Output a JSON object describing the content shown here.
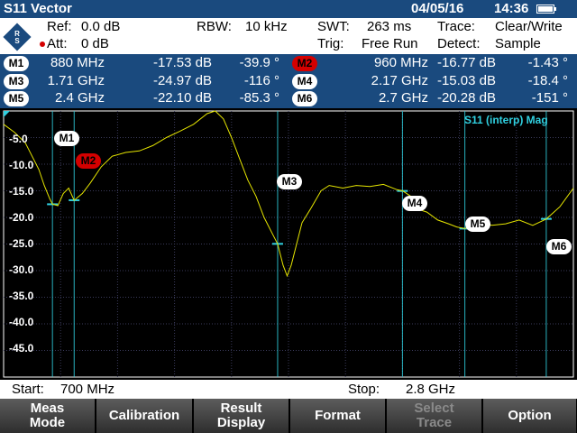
{
  "title_bar": {
    "title": "S11 Vector",
    "date": "04/05/16",
    "time": "14:36"
  },
  "settings": {
    "ref_label": "Ref:",
    "ref_value": "0.0 dB",
    "att_label": "Att:",
    "att_value": "0 dB",
    "rbw_label": "RBW:",
    "rbw_value": "10 kHz",
    "swt_label": "SWT:",
    "swt_value": "263 ms",
    "trig_label": "Trig:",
    "trig_value": "Free Run",
    "trace_label": "Trace:",
    "trace_value": "Clear/Write",
    "detect_label": "Detect:",
    "detect_value": "Sample"
  },
  "markers": [
    {
      "id": "M1",
      "freq": "880 MHz",
      "mag": "-17.53 dB",
      "phase": "-39.9 °",
      "active": false
    },
    {
      "id": "M2",
      "freq": "960 MHz",
      "mag": "-16.77 dB",
      "phase": "-1.43 °",
      "active": true
    },
    {
      "id": "M3",
      "freq": "1.71 GHz",
      "mag": "-24.97 dB",
      "phase": "-116 °",
      "active": false
    },
    {
      "id": "M4",
      "freq": "2.17 GHz",
      "mag": "-15.03 dB",
      "phase": "-18.4 °",
      "active": false
    },
    {
      "id": "M5",
      "freq": "2.4 GHz",
      "mag": "-22.10 dB",
      "phase": "-85.3 °",
      "active": false
    },
    {
      "id": "M6",
      "freq": "2.7 GHz",
      "mag": "-20.28 dB",
      "phase": "-151 °",
      "active": false
    }
  ],
  "plot": {
    "trace_label": "S11 (interp) Mag",
    "y_ticks": [
      "-5.0",
      "-10.0",
      "-15.0",
      "-20.0",
      "-25.0",
      "-30.0",
      "-35.0",
      "-40.0",
      "-45.0"
    ],
    "trace_color": "#e6e600",
    "marker_line_color": "#30d0e0"
  },
  "chart_data": {
    "type": "line",
    "title": "S11 (interp) Mag",
    "xlabel": "",
    "ylabel": "",
    "xlim": [
      700,
      2800
    ],
    "ylim": [
      -50,
      0
    ],
    "x_unit": "MHz",
    "y_unit": "dB",
    "grid": true,
    "series": [
      {
        "name": "S11 (interp) Mag",
        "x": [
          700,
          740,
          780,
          800,
          830,
          850,
          870,
          880,
          900,
          920,
          940,
          960,
          990,
          1020,
          1060,
          1100,
          1150,
          1200,
          1250,
          1300,
          1350,
          1400,
          1450,
          1480,
          1510,
          1540,
          1570,
          1600,
          1630,
          1660,
          1690,
          1710,
          1730,
          1745,
          1760,
          1780,
          1800,
          1830,
          1870,
          1900,
          1950,
          2000,
          2050,
          2100,
          2150,
          2170,
          2200,
          2230,
          2260,
          2300,
          2340,
          2370,
          2400,
          2450,
          2500,
          2550,
          2600,
          2650,
          2700,
          2750,
          2800
        ],
        "y": [
          -2.5,
          -4.0,
          -6.0,
          -8.0,
          -11.0,
          -14.0,
          -16.5,
          -17.5,
          -17.8,
          -15.5,
          -14.5,
          -16.8,
          -15.5,
          -13.5,
          -10.5,
          -8.5,
          -7.8,
          -7.5,
          -6.5,
          -5.0,
          -3.8,
          -2.5,
          -0.5,
          0.0,
          -1.5,
          -5.0,
          -9.0,
          -13.0,
          -16.0,
          -20.0,
          -23.0,
          -25.0,
          -29.0,
          -31.0,
          -29.0,
          -25.0,
          -21.0,
          -18.5,
          -15.0,
          -14.0,
          -14.5,
          -14.0,
          -14.2,
          -13.8,
          -14.8,
          -15.0,
          -16.0,
          -18.5,
          -19.0,
          -20.5,
          -21.2,
          -21.8,
          -22.1,
          -21.0,
          -21.5,
          -21.2,
          -20.5,
          -21.5,
          -20.3,
          -18.0,
          -14.5
        ]
      }
    ]
  },
  "start_stop": {
    "start_label": "Start:",
    "start_value": "700 MHz",
    "stop_label": "Stop:",
    "stop_value": "2.8 GHz"
  },
  "softkeys": [
    {
      "label": "Meas\nMode",
      "enabled": true
    },
    {
      "label": "Calibration",
      "enabled": true
    },
    {
      "label": "Result\nDisplay",
      "enabled": true
    },
    {
      "label": "Format",
      "enabled": true
    },
    {
      "label": "Select\nTrace",
      "enabled": false
    },
    {
      "label": "Option",
      "enabled": true
    }
  ]
}
